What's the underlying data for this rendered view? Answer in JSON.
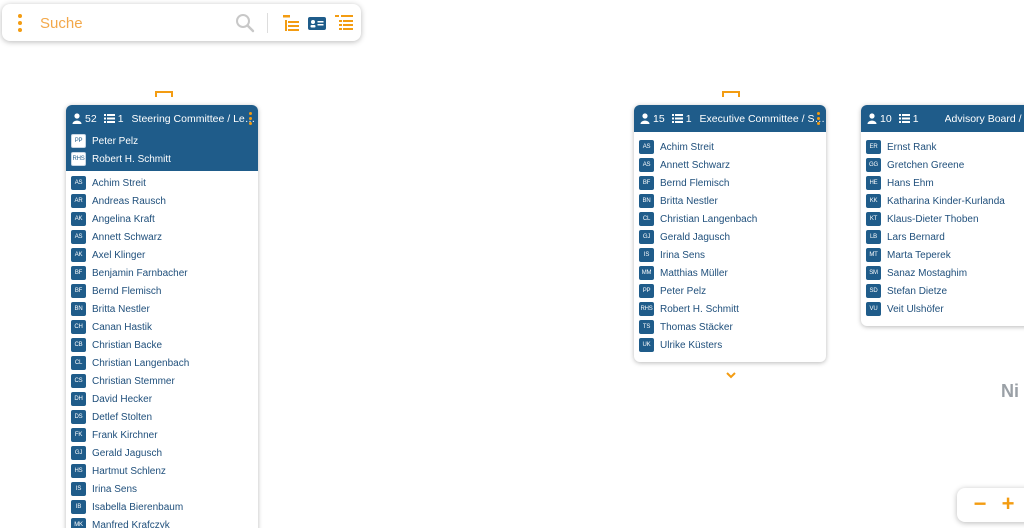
{
  "search": {
    "placeholder": "Suche"
  },
  "colors": {
    "accent": "#f39c12",
    "header": "#1f5c8a",
    "text": "#1f4f7b"
  },
  "cards": [
    {
      "member_count": "52",
      "list_count": "1",
      "title": "Steering Committee / Len...",
      "leads": [
        {
          "initials": "PP",
          "name": "Peter Pelz"
        },
        {
          "initials": "RHS",
          "name": "Robert H. Schmitt"
        }
      ],
      "members": [
        {
          "initials": "AS",
          "name": "Achim Streit"
        },
        {
          "initials": "AR",
          "name": "Andreas Rausch"
        },
        {
          "initials": "AK",
          "name": "Angelina Kraft"
        },
        {
          "initials": "AS",
          "name": "Annett Schwarz"
        },
        {
          "initials": "AK",
          "name": "Axel Klinger"
        },
        {
          "initials": "BF",
          "name": "Benjamin Farnbacher"
        },
        {
          "initials": "BF",
          "name": "Bernd Flemisch"
        },
        {
          "initials": "BN",
          "name": "Britta Nestler"
        },
        {
          "initials": "CH",
          "name": "Canan Hastik"
        },
        {
          "initials": "CB",
          "name": "Christian Backe"
        },
        {
          "initials": "CL",
          "name": "Christian Langenbach"
        },
        {
          "initials": "CS",
          "name": "Christian Stemmer"
        },
        {
          "initials": "DH",
          "name": "David Hecker"
        },
        {
          "initials": "DS",
          "name": "Detlef Stolten"
        },
        {
          "initials": "FK",
          "name": "Frank Kirchner"
        },
        {
          "initials": "GJ",
          "name": "Gerald Jagusch"
        },
        {
          "initials": "HS",
          "name": "Hartmut Schlenz"
        },
        {
          "initials": "IS",
          "name": "Irina Sens"
        },
        {
          "initials": "IB",
          "name": "Isabella Bierenbaum"
        },
        {
          "initials": "MK",
          "name": "Manfred Krafczyk"
        }
      ]
    },
    {
      "member_count": "15",
      "list_count": "1",
      "title": "Executive Committee / St...",
      "members": [
        {
          "initials": "AS",
          "name": "Achim Streit"
        },
        {
          "initials": "AS",
          "name": "Annett Schwarz"
        },
        {
          "initials": "BF",
          "name": "Bernd Flemisch"
        },
        {
          "initials": "BN",
          "name": "Britta Nestler"
        },
        {
          "initials": "CL",
          "name": "Christian Langenbach"
        },
        {
          "initials": "GJ",
          "name": "Gerald Jagusch"
        },
        {
          "initials": "IS",
          "name": "Irina Sens"
        },
        {
          "initials": "MM",
          "name": "Matthias Müller"
        },
        {
          "initials": "PP",
          "name": "Peter Pelz"
        },
        {
          "initials": "RHS",
          "name": "Robert H. Schmitt"
        },
        {
          "initials": "TS",
          "name": "Thomas Stäcker"
        },
        {
          "initials": "UK",
          "name": "Ulrike Küsters"
        }
      ]
    },
    {
      "member_count": "10",
      "list_count": "1",
      "title": "Advisory Board / Be",
      "members": [
        {
          "initials": "ER",
          "name": "Ernst Rank"
        },
        {
          "initials": "GG",
          "name": "Gretchen Greene"
        },
        {
          "initials": "HE",
          "name": "Hans Ehm"
        },
        {
          "initials": "KK",
          "name": "Katharina Kinder-Kurlanda"
        },
        {
          "initials": "KT",
          "name": "Klaus-Dieter Thoben"
        },
        {
          "initials": "LB",
          "name": "Lars Bernard"
        },
        {
          "initials": "MT",
          "name": "Marta Teperek"
        },
        {
          "initials": "SM",
          "name": "Sanaz Mostaghim"
        },
        {
          "initials": "SD",
          "name": "Stefan Dietze"
        },
        {
          "initials": "VU",
          "name": "Veit Ulshöfer"
        }
      ]
    }
  ],
  "partial_text": "Ni",
  "zoom": {
    "minus": "−",
    "plus": "+"
  },
  "icons": {
    "menu": "kebab-menu-icon",
    "search": "search-icon",
    "tree": "tree-view-icon",
    "card": "card-view-icon",
    "list": "list-view-icon",
    "person": "person-icon",
    "roles": "list-icon",
    "expand": "chevron-down-icon"
  }
}
